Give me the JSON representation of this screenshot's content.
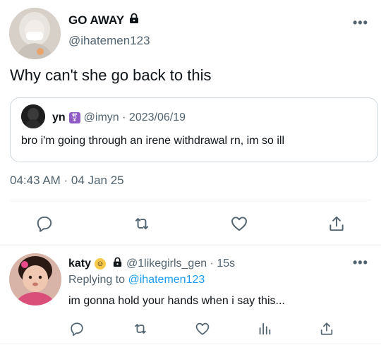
{
  "main_tweet": {
    "display_name": "GO AWAY",
    "handle": "@ihatemen123",
    "text": "Why can't she go back to this",
    "timestamp": "04:43 AM · 04 Jan 25",
    "more_label": "•••"
  },
  "quoted_tweet": {
    "display_name": "yn",
    "handle_date": "@imyn · 2023/06/19",
    "text": "bro i'm going through an irene withdrawal rn, im so ill"
  },
  "main_actions": {
    "reply_icon": "reply-icon",
    "retweet_icon": "retweet-icon",
    "like_icon": "like-icon",
    "share_icon": "share-icon"
  },
  "reply_tweet": {
    "display_name": "katy",
    "handle_time": "@1likegirls_gen · 15s",
    "replying_prefix": "Replying to ",
    "replying_handle": "@ihatemen123",
    "text": "im gonna hold your hands when i say this...",
    "more_label": "•••"
  },
  "colors": {
    "link": "#1d9bf0",
    "muted": "#536471",
    "text": "#0f1419",
    "divider": "#eff3f4"
  }
}
